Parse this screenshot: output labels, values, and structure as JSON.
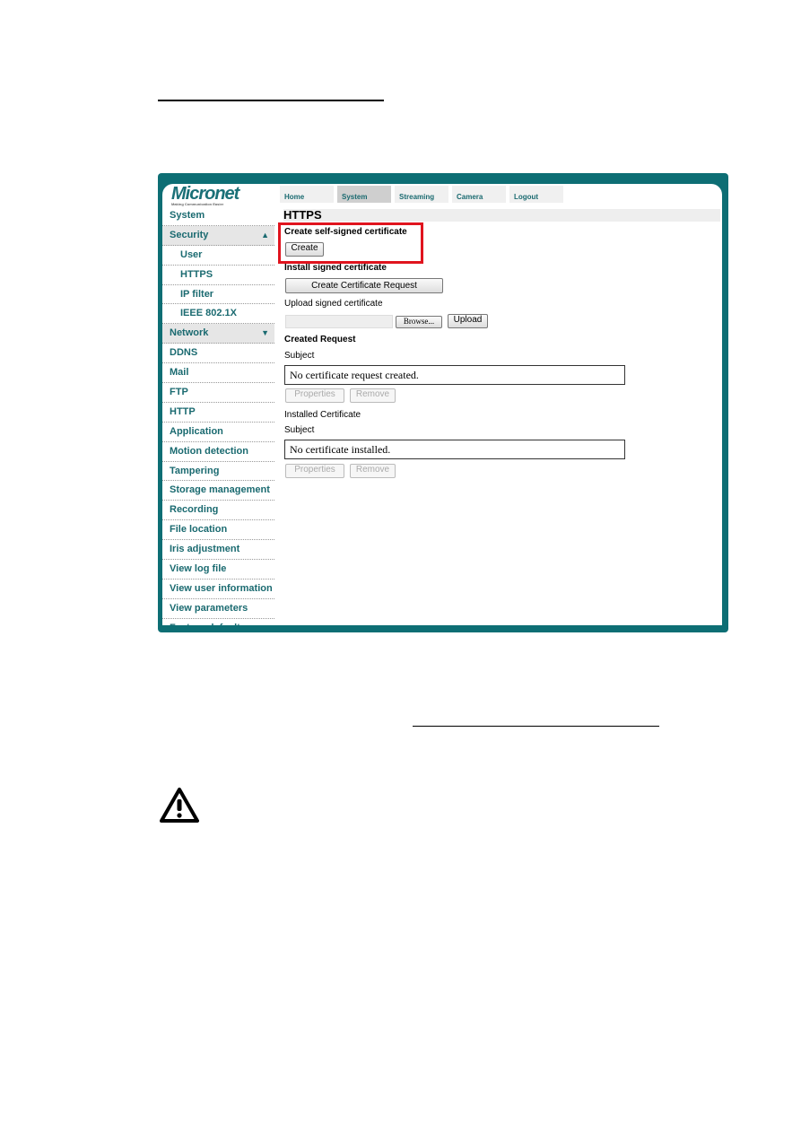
{
  "app": {
    "logo": "Micronet",
    "tagline": "Making Communication Easier"
  },
  "tabs": [
    {
      "label": "Home"
    },
    {
      "label": "System"
    },
    {
      "label": "Streaming"
    },
    {
      "label": "Camera"
    },
    {
      "label": "Logout"
    }
  ],
  "sidebar": {
    "items": [
      {
        "label": "System"
      },
      {
        "label": "Security"
      },
      {
        "label": "User"
      },
      {
        "label": "HTTPS"
      },
      {
        "label": "IP filter"
      },
      {
        "label": "IEEE 802.1X"
      },
      {
        "label": "Network"
      },
      {
        "label": "DDNS"
      },
      {
        "label": "Mail"
      },
      {
        "label": "FTP"
      },
      {
        "label": "HTTP"
      },
      {
        "label": "Application"
      },
      {
        "label": "Motion detection"
      },
      {
        "label": "Tampering"
      },
      {
        "label": "Storage management"
      },
      {
        "label": "Recording"
      },
      {
        "label": "File location"
      },
      {
        "label": "Iris adjustment"
      },
      {
        "label": "View log file"
      },
      {
        "label": "View user information"
      },
      {
        "label": "View parameters"
      },
      {
        "label": "Factory default"
      }
    ],
    "expand_up": "▲",
    "expand_down": "▼"
  },
  "main": {
    "title": "HTTPS",
    "self_signed_heading": "Create self-signed certificate",
    "create_label": "Create",
    "install_heading": "Install signed certificate",
    "create_request_label": "Create Certificate Request",
    "upload_label_text": "Upload signed certificate",
    "file_value": "",
    "browse_label": "Browse...",
    "upload_label": "Upload",
    "created_request_heading": "Created Request",
    "subject_label": "Subject",
    "request_value": "No certificate request created.",
    "properties_label": "Properties",
    "remove_label": "Remove",
    "installed_heading": "Installed Certificate",
    "installed_value": "No certificate installed."
  },
  "colors": {
    "frame": "#0d6e74",
    "highlight": "#e0141e",
    "nav_text": "#1a6a70"
  }
}
